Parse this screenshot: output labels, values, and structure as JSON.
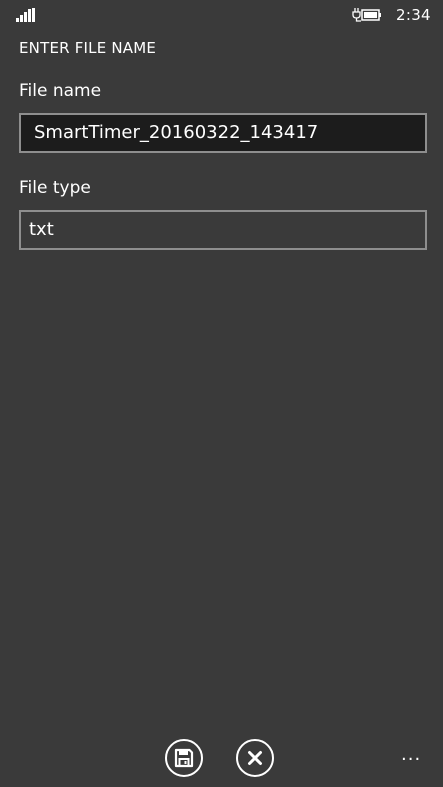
{
  "status": {
    "time": "2:34",
    "icons": [
      "signal-strength-icon",
      "battery-charging-icon"
    ]
  },
  "page": {
    "title": "ENTER FILE NAME"
  },
  "form": {
    "file_name_label": "File name",
    "file_name_value": "SmartTimer_20160322_143417",
    "file_type_label": "File type",
    "file_type_value": "txt"
  },
  "app_bar": {
    "buttons": [
      "save-icon",
      "cancel-icon"
    ],
    "more_label": "..."
  },
  "colors": {
    "background": "#3a3a3a",
    "focused_field_background": "#1c1c1c",
    "field_border": "#8e8e8e",
    "text": "#ffffff"
  }
}
